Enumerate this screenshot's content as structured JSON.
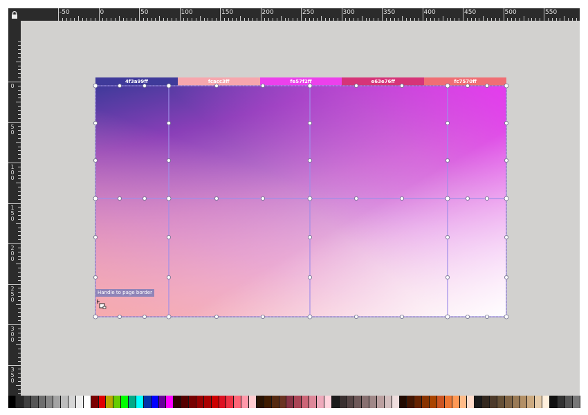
{
  "ruler": {
    "corner_icon": "lock-icon",
    "h_labels": [
      "-50",
      "0",
      "50",
      "100",
      "150",
      "200",
      "250",
      "300",
      "350",
      "400",
      "450",
      "500",
      "550"
    ],
    "v_labels": [
      "0",
      "50",
      "100",
      "150",
      "200",
      "250",
      "300",
      "350"
    ]
  },
  "gradient": {
    "stops": [
      {
        "label": "4f3a99ff",
        "color": "#3f3a9a"
      },
      {
        "label": "fcacc3ff",
        "color": "#f7a6ad"
      },
      {
        "label": "fe57f2ff",
        "color": "#ec40ec"
      },
      {
        "label": "e63e76ff",
        "color": "#d63478"
      },
      {
        "label": "fc7570ff",
        "color": "#f06e74"
      }
    ]
  },
  "tooltip": {
    "text": "Handle to page border"
  },
  "cursor": {
    "icon": "snap-cursor-icon"
  },
  "palette": {
    "colors": [
      "#000000",
      "#262626",
      "#404040",
      "#555555",
      "#6e6e6e",
      "#888888",
      "#a3a3a3",
      "#bdbdbd",
      "#d6d6d6",
      "#eeeeee",
      "#ffffff",
      "#7a0000",
      "#e00000",
      "#b8a800",
      "#66cc00",
      "#00ff00",
      "#00aa88",
      "#00ffff",
      "#0033aa",
      "#0000ff",
      "#660099",
      "#ff00ff",
      "#330000",
      "#550000",
      "#770000",
      "#990000",
      "#aa0000",
      "#cc0000",
      "#dd1122",
      "#ee3344",
      "#ff6677",
      "#ff99aa",
      "#ffccd0",
      "#2a1200",
      "#3f1b00",
      "#552a11",
      "#6a3322",
      "#883344",
      "#aa4455",
      "#cc6677",
      "#dd8899",
      "#eeaabb",
      "#ffd4dd",
      "#1c1c1c",
      "#3a3030",
      "#554444",
      "#6e5858",
      "#887070",
      "#a08888",
      "#bba0a0",
      "#d4c0c0",
      "#eedddd",
      "#220a00",
      "#441500",
      "#662200",
      "#883300",
      "#aa4400",
      "#cc5522",
      "#ee7733",
      "#ff9955",
      "#ffbb88",
      "#ffddcc",
      "#1a1a1a",
      "#33281e",
      "#4d3a2a",
      "#665036",
      "#806444",
      "#9a7a55",
      "#b39066",
      "#ccaa80",
      "#e6ccaa",
      "#fff0dd",
      "#111111",
      "#333333",
      "#555555",
      "#777777"
    ]
  }
}
